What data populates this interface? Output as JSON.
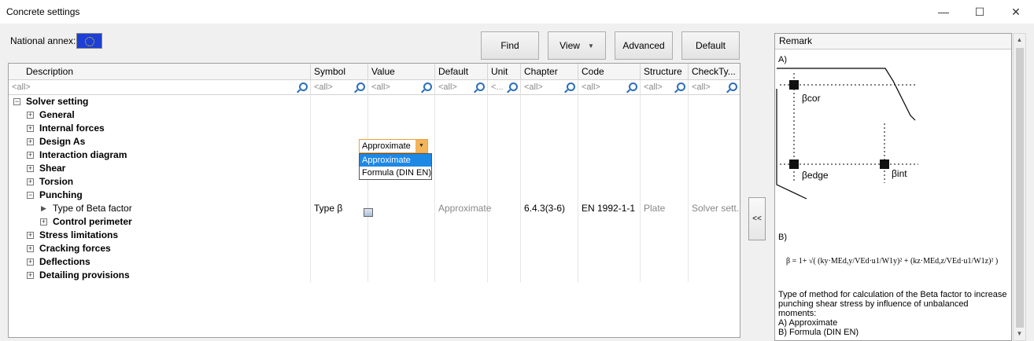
{
  "window": {
    "title": "Concrete settings",
    "minimize": "—",
    "maximize": "☐",
    "close": "✕"
  },
  "toolbar": {
    "national_annex_label": "National annex:",
    "find_label": "Find",
    "view_label": "View",
    "advanced_label": "Advanced",
    "default_label": "Default"
  },
  "grid": {
    "columns": [
      "Description",
      "Symbol",
      "Value",
      "Default",
      "Unit",
      "Chapter",
      "Code",
      "Structure",
      "CheckTy..."
    ],
    "filters": [
      "<all>",
      "<all>",
      "<all>",
      "<all>",
      "<...",
      "<all>",
      "<all>",
      "<all>",
      "<all>"
    ],
    "rows": [
      {
        "label": "Solver setting",
        "pm": "⊟"
      },
      {
        "label": "General",
        "pm": "⊞"
      },
      {
        "label": "Internal forces",
        "pm": "⊞"
      },
      {
        "label": "Design As",
        "pm": "⊞"
      },
      {
        "label": "Interaction diagram",
        "pm": "⊞"
      },
      {
        "label": "Shear",
        "pm": "⊞"
      },
      {
        "label": "Torsion",
        "pm": "⊞"
      },
      {
        "label": "Punching",
        "pm": "⊟"
      },
      {
        "label": "Type of Beta factor",
        "symbol": "Type β",
        "default": "Approximate",
        "chapter": "6.4.3(3-6)",
        "code": "EN 1992-1-1",
        "structure": "Plate",
        "check": "Solver sett..."
      },
      {
        "label": "Control perimeter",
        "pm": "⊞"
      },
      {
        "label": "Stress limitations",
        "pm": "⊞"
      },
      {
        "label": "Cracking forces",
        "pm": "⊞"
      },
      {
        "label": "Deflections",
        "pm": "⊞"
      },
      {
        "label": "Detailing provisions",
        "pm": "⊞"
      }
    ]
  },
  "value_editor": {
    "current": "Approximate",
    "options": [
      "Approximate",
      "Formula (DIN EN)"
    ]
  },
  "collapse_button": "<<",
  "remark": {
    "header": "Remark",
    "label_a": "A)",
    "label_b": "B)",
    "beta_cor": "βcor",
    "beta_edge": "βedge",
    "beta_int": "βint",
    "formula": "β = 1+ √( (ky·MEd,y/VEd·u1/W1y)² + (kz·MEd,z/VEd·u1/W1z)² )",
    "description_lines": [
      "Type of method for calculation of the Beta factor to increase",
      "punching shear stress by influence of unbalanced moments:",
      "A) Approximate",
      "B) Formula (DIN EN)"
    ]
  }
}
